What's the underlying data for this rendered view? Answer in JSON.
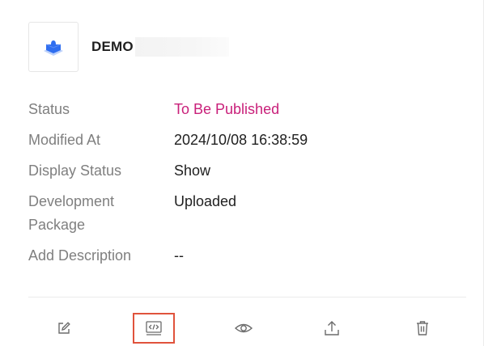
{
  "app": {
    "name": "DEMO",
    "logo_icon": "puzzle-piece-icon"
  },
  "details": [
    {
      "label": "Status",
      "value": "To Be Published"
    },
    {
      "label": "Modified At",
      "value": "2024/10/08 16:38:59"
    },
    {
      "label": "Display Status",
      "value": "Show"
    },
    {
      "label": "Development Package",
      "value": "Uploaded"
    },
    {
      "label": "Add Description",
      "value": "--"
    }
  ],
  "toolbar": [
    {
      "icon": "edit-icon"
    },
    {
      "icon": "code-icon",
      "highlighted": true
    },
    {
      "icon": "eye-icon"
    },
    {
      "icon": "upload-icon"
    },
    {
      "icon": "trash-icon"
    }
  ],
  "colors": {
    "status_pending": "#c9207a",
    "highlight_border": "#e0533c",
    "label": "#7f7f7f",
    "logo_blue": "#2f6ef0"
  }
}
